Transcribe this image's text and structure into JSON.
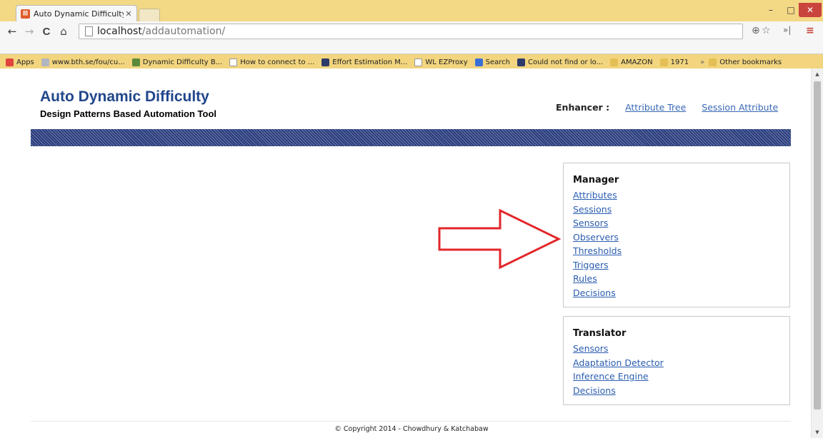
{
  "browser": {
    "tab_title": "Auto Dynamic Difficulty A",
    "tab_favicon": "xampp-favicon-icon",
    "url_host": "localhost",
    "url_path": "/addautomation/",
    "window_controls": {
      "minimize": "–",
      "maximize": "□",
      "close": "✕"
    },
    "nav": {
      "back": "←",
      "forward": "→",
      "reload": "C",
      "home": "⌂"
    },
    "omnibox_zoom": "⊕",
    "omnibox_star": "☆",
    "extensions": "»|",
    "menu": "≡"
  },
  "bookmarks": {
    "items": [
      {
        "label": "Apps",
        "icon": "apps-grid-icon",
        "color": "#e0443c"
      },
      {
        "label": "www.bth.se/fou/cu...",
        "icon": "globe-icon",
        "color": "#b0b6c2"
      },
      {
        "label": "Dynamic Difficulty B...",
        "icon": "dynamic-logo-icon",
        "color": "#5a8a3a"
      },
      {
        "label": "How to connect to ...",
        "icon": "page-icon",
        "color": "#ffffff"
      },
      {
        "label": "Effort Estimation M...",
        "icon": "igi-icon",
        "color": "#2c3c6a"
      },
      {
        "label": "WL EZProxy",
        "icon": "page-icon",
        "color": "#ffffff"
      },
      {
        "label": "Search",
        "icon": "google-search-icon",
        "color": "#3a6fd8"
      },
      {
        "label": "Could not find or lo...",
        "icon": "vs-icon",
        "color": "#2d3a6a"
      },
      {
        "label": "AMAZON",
        "icon": "folder-icon",
        "color": "#e3bf55"
      },
      {
        "label": "1971",
        "icon": "folder-icon",
        "color": "#e3bf55"
      }
    ],
    "overflow": "»",
    "other": {
      "label": "Other bookmarks",
      "icon": "folder-icon",
      "color": "#e3bf55"
    }
  },
  "site": {
    "title": "Auto Dynamic Difficulty",
    "subtitle": "Design Patterns Based Automation Tool",
    "enhancer_label": "Enhancer :",
    "nav_links": [
      "Attribute Tree",
      "Session Attribute"
    ]
  },
  "manager": {
    "heading": "Manager",
    "links": [
      "Attributes",
      "Sessions",
      "Sensors",
      "Observers",
      "Thresholds",
      "Triggers",
      "Rules",
      "Decisions"
    ]
  },
  "translator": {
    "heading": "Translator",
    "links": [
      "Sensors",
      "Adaptation Detector",
      "Inference Engine",
      "Decisions"
    ]
  },
  "footer": {
    "copyright": "© Copyright 2014 - Chowdhury & Katchabaw"
  },
  "colors": {
    "title_blue": "#21468b",
    "link_blue": "#2a5db0",
    "banner": "#2a3d7c",
    "arrow": "#e3262a"
  },
  "scrollbar": {
    "up": "▲",
    "down": "▼"
  }
}
